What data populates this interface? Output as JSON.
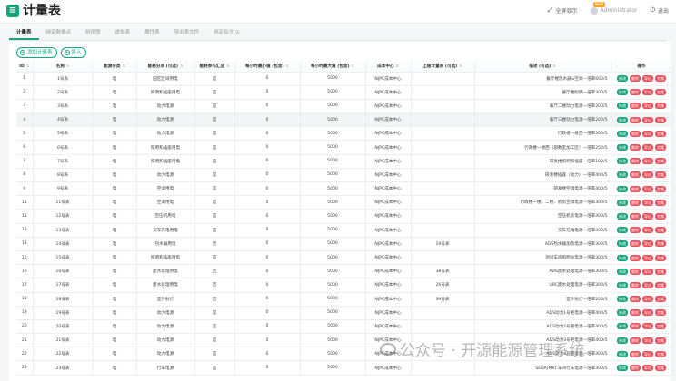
{
  "app": {
    "logo_glyph": "≡",
    "title": "计量表"
  },
  "header": {
    "fullscreen_label": "全屏显示",
    "new_badge": "NEW",
    "user_name": "Administrator",
    "logout_label": "退出"
  },
  "tabs": [
    {
      "label": "计量表",
      "active": true
    },
    {
      "label": "绑定数据点",
      "active": false
    },
    {
      "label": "树视图",
      "active": false
    },
    {
      "label": "虚拟表",
      "active": false
    },
    {
      "label": "属性表",
      "active": false
    },
    {
      "label": "导出表文件",
      "active": false
    },
    {
      "label": "绑定指令 ①",
      "active": false
    }
  ],
  "toolbar": {
    "add_label": "添加计量表",
    "import_label": "导入"
  },
  "table": {
    "columns": [
      "ID",
      "名称",
      "能源分类",
      "能耗分项 (可选)",
      "能耗参与汇总",
      "每小时最小值 (包含)",
      "每小时最大值 (包含)",
      "成本中心",
      "上级计量表 (可选)",
      "描述 (可选)",
      "操作"
    ],
    "ops": {
      "edit": "修改",
      "delete": "删除",
      "export": "导出",
      "clone": "克隆"
    },
    "rows": [
      {
        "id": "1",
        "name": "1号表",
        "cat": "电",
        "sub": "园区区域用电",
        "sum": "是",
        "min": "0",
        "max": "5000",
        "cost": "NJPC成本中心",
        "parent": "",
        "desc": "餐厅楼热水器&空调—倍率600/5",
        "hl": false
      },
      {
        "id": "2",
        "name": "2号表",
        "cat": "电",
        "sub": "照明和插座用电",
        "sum": "是",
        "min": "0",
        "max": "5000",
        "cost": "NJPC成本中心",
        "parent": "",
        "desc": "餐厅楼照明—倍率300/5",
        "hl": false
      },
      {
        "id": "3",
        "name": "3号表",
        "cat": "电",
        "sub": "动力电源",
        "sum": "是",
        "min": "0",
        "max": "5000",
        "cost": "NJPC成本中心",
        "parent": "",
        "desc": "餐厅二楼动力电源—倍率200/5",
        "hl": false
      },
      {
        "id": "4",
        "name": "4号表",
        "cat": "电",
        "sub": "动力电源",
        "sum": "是",
        "min": "0",
        "max": "5000",
        "cost": "NJPC成本中心",
        "parent": "",
        "desc": "餐厅三楼动力电源—倍率200/5",
        "hl": true
      },
      {
        "id": "5",
        "name": "5号表",
        "cat": "电",
        "sub": "动力电源",
        "sum": "是",
        "min": "0",
        "max": "5000",
        "cost": "NJPC成本中心",
        "parent": "",
        "desc": "行政楼一楼西—倍率300/5",
        "hl": false
      },
      {
        "id": "6",
        "name": "6号表",
        "cat": "电",
        "sub": "照明和插座用电",
        "sum": "是",
        "min": "0",
        "max": "5000",
        "cost": "NJPC成本中心",
        "parent": "",
        "desc": "行政楼一楼西（部数室加工区）—倍率250/5",
        "hl": false
      },
      {
        "id": "7",
        "name": "7号表",
        "cat": "电",
        "sub": "照明和插座用电",
        "sum": "是",
        "min": "0",
        "max": "5000",
        "cost": "NJPC成本中心",
        "parent": "",
        "desc": "研发楼照明和插座—倍率100/5",
        "hl": false
      },
      {
        "id": "8",
        "name": "8号表",
        "cat": "电",
        "sub": "动力电源",
        "sum": "是",
        "min": "0",
        "max": "5000",
        "cost": "NJPC成本中心",
        "parent": "",
        "desc": "研发楼插座（动力）—倍率400/5",
        "hl": false
      },
      {
        "id": "9",
        "name": "9号表",
        "cat": "电",
        "sub": "空调用电",
        "sum": "是",
        "min": "0",
        "max": "5000",
        "cost": "NJPC成本中心",
        "parent": "",
        "desc": "研发楼空调电源—倍率400/5",
        "hl": false
      },
      {
        "id": "11",
        "name": "11号表",
        "cat": "电",
        "sub": "空调用电",
        "sum": "是",
        "min": "0",
        "max": "5000",
        "cost": "NJPC成本中心",
        "parent": "",
        "desc": "行政楼一楼、二楼、机房空调电源—倍率300/5",
        "hl": false
      },
      {
        "id": "12",
        "name": "12号表",
        "cat": "电",
        "sub": "空压机用电",
        "sum": "是",
        "min": "0",
        "max": "5000",
        "cost": "NJPC成本中心",
        "parent": "",
        "desc": "空压机房电源—倍率400/5",
        "hl": false
      },
      {
        "id": "13",
        "name": "13号表",
        "cat": "电",
        "sub": "叉车充电用电",
        "sum": "是",
        "min": "0",
        "max": "5000",
        "cost": "NJPC成本中心",
        "parent": "",
        "desc": "叉车充电电源—倍率300/5",
        "hl": false
      },
      {
        "id": "14",
        "name": "14号表",
        "cat": "电",
        "sub": "热水器用电",
        "sum": "否",
        "min": "0",
        "max": "5000",
        "cost": "NJPC成本中心",
        "parent": "19号表",
        "desc": "ADS热水器加热电源—倍率300/5",
        "hl": false
      },
      {
        "id": "15",
        "name": "15号表",
        "cat": "电",
        "sub": "照明和插座用电",
        "sum": "是",
        "min": "0",
        "max": "5000",
        "cost": "NJPC成本中心",
        "parent": "",
        "desc": "测试车间照明总电源—倍率300/5",
        "hl": false
      },
      {
        "id": "16",
        "name": "16号表",
        "cat": "电",
        "sub": "废水处理用电",
        "sum": "否",
        "min": "0",
        "max": "5000",
        "cost": "NJPC成本中心",
        "parent": "38号表",
        "desc": "ADS废水处理电源—倍率300/5",
        "hl": false
      },
      {
        "id": "17",
        "name": "17号表",
        "cat": "电",
        "sub": "废水处理用电",
        "sum": "否",
        "min": "0",
        "max": "5000",
        "cost": "NJPC成本中心",
        "parent": "26号表",
        "desc": "URC废水处理电源—倍率300/5",
        "hl": false
      },
      {
        "id": "18",
        "name": "18号表",
        "cat": "电",
        "sub": "室外射灯",
        "sum": "否",
        "min": "0",
        "max": "5000",
        "cost": "NJPC成本中心",
        "parent": "39号表",
        "desc": "室外射灯—倍率200/5",
        "hl": false
      },
      {
        "id": "19",
        "name": "19号表",
        "cat": "电",
        "sub": "动力电源",
        "sum": "是",
        "min": "0",
        "max": "5000",
        "cost": "NJPC成本中心",
        "parent": "",
        "desc": "ADS动力1号柜电源—倍率400/5",
        "hl": false
      },
      {
        "id": "20",
        "name": "20号表",
        "cat": "电",
        "sub": "动力电源",
        "sum": "是",
        "min": "0",
        "max": "5000",
        "cost": "NJPC成本中心",
        "parent": "",
        "desc": "ADS动力2号柜电源—倍率400/5",
        "hl": false
      },
      {
        "id": "21",
        "name": "21号表",
        "cat": "电",
        "sub": "动力电源",
        "sum": "是",
        "min": "0",
        "max": "5000",
        "cost": "NJPC成本中心",
        "parent": "",
        "desc": "ADS动力3号柜电源—倍率400/5",
        "hl": false
      },
      {
        "id": "22",
        "name": "22号表",
        "cat": "电",
        "sub": "动力电源",
        "sum": "是",
        "min": "0",
        "max": "5000",
        "cost": "NJPC成本中心",
        "parent": "",
        "desc": "ADS动力4号柜电源—倍率400/5",
        "hl": false
      },
      {
        "id": "23",
        "name": "23号表",
        "cat": "电",
        "sub": "行车电源",
        "sum": "是",
        "min": "0",
        "max": "5000",
        "cost": "NJPC成本中心",
        "parent": "",
        "desc": "SEDA(MR) 车间行车电源—倍率300/5",
        "hl": false
      }
    ]
  },
  "watermark": {
    "text": "公众号 · 开源能源管理系统"
  }
}
